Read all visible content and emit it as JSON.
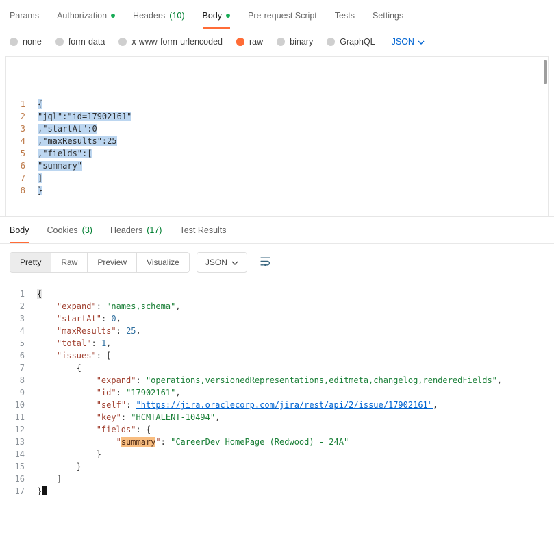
{
  "colors": {
    "accent_orange": "#ff6c37",
    "green_dot": "#18ab56",
    "count_green": "#007f31",
    "link_blue": "#0265d2",
    "selection_blue": "#bcd6f0",
    "match_highlight": "#f8bd80",
    "json_key": "#a14232",
    "json_string": "#1a7f37",
    "json_number": "#2f6f9f"
  },
  "request_tabs": {
    "params": "Params",
    "authorization": "Authorization",
    "headers": "Headers",
    "headers_count": "(10)",
    "body": "Body",
    "pre_request": "Pre-request Script",
    "tests": "Tests",
    "settings": "Settings"
  },
  "body_type_bar": {
    "none": "none",
    "form_data": "form-data",
    "urlencoded": "x-www-form-urlencoded",
    "raw": "raw",
    "binary": "binary",
    "graphql": "GraphQL",
    "language": "JSON",
    "selected": "raw"
  },
  "request_editor": {
    "lines": [
      {
        "n": "1",
        "tokens": [
          {
            "t": "sel",
            "v": "{"
          }
        ]
      },
      {
        "n": "2",
        "tokens": [
          {
            "t": "sel",
            "v": "\"jql\":\"id=17902161\""
          }
        ]
      },
      {
        "n": "3",
        "tokens": [
          {
            "t": "sel",
            "v": ",\"startAt\":0"
          }
        ]
      },
      {
        "n": "4",
        "tokens": [
          {
            "t": "sel",
            "v": ",\"maxResults\":25"
          }
        ]
      },
      {
        "n": "5",
        "tokens": [
          {
            "t": "sel",
            "v": ",\"fields\":["
          }
        ]
      },
      {
        "n": "6",
        "tokens": [
          {
            "t": "sel",
            "v": "\"summary\""
          }
        ]
      },
      {
        "n": "7",
        "tokens": [
          {
            "t": "sel",
            "v": "]"
          }
        ]
      },
      {
        "n": "8",
        "tokens": [
          {
            "t": "sel",
            "v": "}"
          }
        ]
      }
    ]
  },
  "response_tabs": {
    "body": "Body",
    "cookies": "Cookies",
    "cookies_count": "(3)",
    "headers": "Headers",
    "headers_count": "(17)",
    "test_results": "Test Results"
  },
  "response_toolbar": {
    "modes": [
      "Pretty",
      "Raw",
      "Preview",
      "Visualize"
    ],
    "active_mode": "Pretty",
    "language": "JSON"
  },
  "response_editor": {
    "lines": [
      {
        "n": "1",
        "tokens": [
          {
            "t": "bm",
            "v": "{"
          }
        ]
      },
      {
        "n": "2",
        "tokens": [
          {
            "t": "p",
            "v": "    "
          },
          {
            "t": "k",
            "v": "\"expand\""
          },
          {
            "t": "p",
            "v": ": "
          },
          {
            "t": "s",
            "v": "\"names,schema\""
          },
          {
            "t": "p",
            "v": ","
          }
        ]
      },
      {
        "n": "3",
        "tokens": [
          {
            "t": "p",
            "v": "    "
          },
          {
            "t": "k",
            "v": "\"startAt\""
          },
          {
            "t": "p",
            "v": ": "
          },
          {
            "t": "n",
            "v": "0"
          },
          {
            "t": "p",
            "v": ","
          }
        ]
      },
      {
        "n": "4",
        "tokens": [
          {
            "t": "p",
            "v": "    "
          },
          {
            "t": "k",
            "v": "\"maxResults\""
          },
          {
            "t": "p",
            "v": ": "
          },
          {
            "t": "n",
            "v": "25"
          },
          {
            "t": "p",
            "v": ","
          }
        ]
      },
      {
        "n": "5",
        "tokens": [
          {
            "t": "p",
            "v": "    "
          },
          {
            "t": "k",
            "v": "\"total\""
          },
          {
            "t": "p",
            "v": ": "
          },
          {
            "t": "n",
            "v": "1"
          },
          {
            "t": "p",
            "v": ","
          }
        ]
      },
      {
        "n": "6",
        "tokens": [
          {
            "t": "p",
            "v": "    "
          },
          {
            "t": "k",
            "v": "\"issues\""
          },
          {
            "t": "p",
            "v": ": ["
          }
        ]
      },
      {
        "n": "7",
        "tokens": [
          {
            "t": "p",
            "v": "        {"
          }
        ]
      },
      {
        "n": "8",
        "tokens": [
          {
            "t": "p",
            "v": "            "
          },
          {
            "t": "k",
            "v": "\"expand\""
          },
          {
            "t": "p",
            "v": ": "
          },
          {
            "t": "s",
            "v": "\"operations,versionedRepresentations,editmeta,changelog,renderedFields\""
          },
          {
            "t": "p",
            "v": ","
          }
        ]
      },
      {
        "n": "9",
        "tokens": [
          {
            "t": "p",
            "v": "            "
          },
          {
            "t": "k",
            "v": "\"id\""
          },
          {
            "t": "p",
            "v": ": "
          },
          {
            "t": "s",
            "v": "\"17902161\""
          },
          {
            "t": "p",
            "v": ","
          }
        ]
      },
      {
        "n": "10",
        "tokens": [
          {
            "t": "p",
            "v": "            "
          },
          {
            "t": "k",
            "v": "\"self\""
          },
          {
            "t": "p",
            "v": ": "
          },
          {
            "t": "link",
            "v": "\"https://jira.oraclecorp.com/jira/rest/api/2/issue/17902161\""
          },
          {
            "t": "p",
            "v": ","
          }
        ]
      },
      {
        "n": "11",
        "tokens": [
          {
            "t": "p",
            "v": "            "
          },
          {
            "t": "k",
            "v": "\"key\""
          },
          {
            "t": "p",
            "v": ": "
          },
          {
            "t": "s",
            "v": "\"HCMTALENT-10494\""
          },
          {
            "t": "p",
            "v": ","
          }
        ]
      },
      {
        "n": "12",
        "tokens": [
          {
            "t": "p",
            "v": "            "
          },
          {
            "t": "k",
            "v": "\"fields\""
          },
          {
            "t": "p",
            "v": ": {"
          }
        ]
      },
      {
        "n": "13",
        "tokens": [
          {
            "t": "p",
            "v": "                "
          },
          {
            "t": "k",
            "v": "\""
          },
          {
            "t": "hl",
            "v": "summary"
          },
          {
            "t": "k",
            "v": "\""
          },
          {
            "t": "p",
            "v": ": "
          },
          {
            "t": "s",
            "v": "\"CareerDev HomePage (Redwood) - 24A\""
          }
        ]
      },
      {
        "n": "14",
        "tokens": [
          {
            "t": "p",
            "v": "            }"
          }
        ]
      },
      {
        "n": "15",
        "tokens": [
          {
            "t": "p",
            "v": "        }"
          }
        ]
      },
      {
        "n": "16",
        "tokens": [
          {
            "t": "p",
            "v": "    ]"
          }
        ]
      },
      {
        "n": "17",
        "tokens": [
          {
            "t": "p",
            "v": "}"
          }
        ],
        "cursor": true
      }
    ]
  }
}
